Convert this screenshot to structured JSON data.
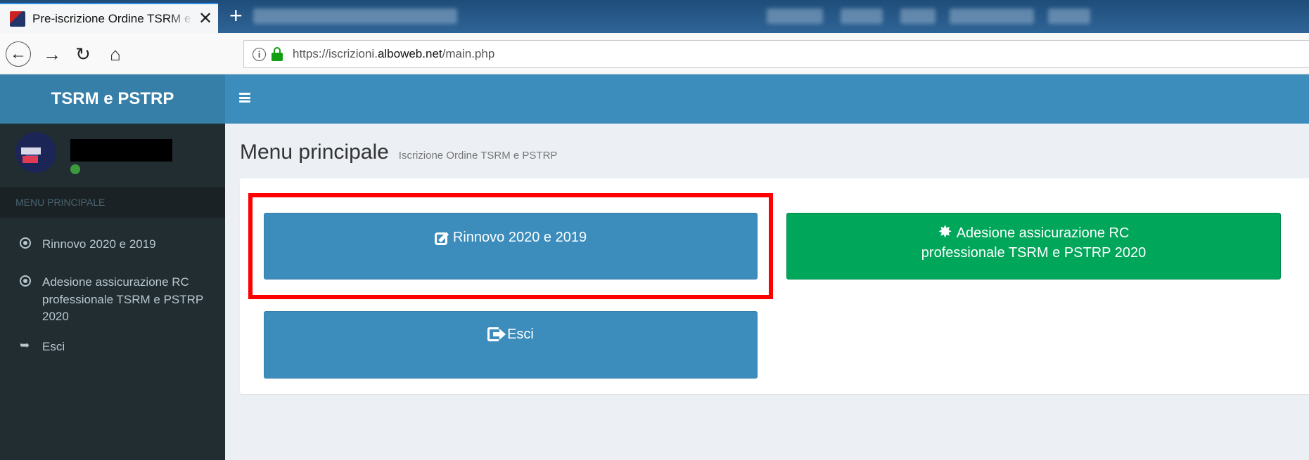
{
  "browser": {
    "tab_title": "Pre-iscrizione Ordine TSRM e PSTRP",
    "tab_close": "✕",
    "new_tab": "+",
    "url_prefix": "https://iscrizioni.",
    "url_domain": "alboweb.net",
    "url_path": "/main.php",
    "nav": {
      "back": "←",
      "forward": "→",
      "reload": "↻",
      "home": "⌂",
      "info": "i"
    }
  },
  "app": {
    "logo": "TSRM e PSTRP",
    "colors": {
      "header": "#3c8dbc",
      "logo_bar": "#367fa9",
      "sidebar": "#222d32",
      "success": "#00a65a",
      "highlight": "#ff0000"
    }
  },
  "sidebar": {
    "header": "MENU PRINCIPALE",
    "items": [
      {
        "label": "Rinnovo 2020 e 2019",
        "icon": "radio-circle-icon"
      },
      {
        "label": "Adesione assicurazione RC professionale TSRM e PSTRP 2020",
        "icon": "radio-circle-icon"
      },
      {
        "label": "Esci",
        "icon": "sign-out-icon"
      }
    ]
  },
  "content": {
    "title": "Menu principale",
    "subtitle": "Iscrizione Ordine TSRM e PSTRP",
    "buttons": {
      "rinnovo": "Rinnovo 2020 e 2019",
      "assicurazione_line1": "Adesione assicurazione RC",
      "assicurazione_line2": "professionale TSRM e PSTRP 2020",
      "esci": "Esci"
    }
  }
}
